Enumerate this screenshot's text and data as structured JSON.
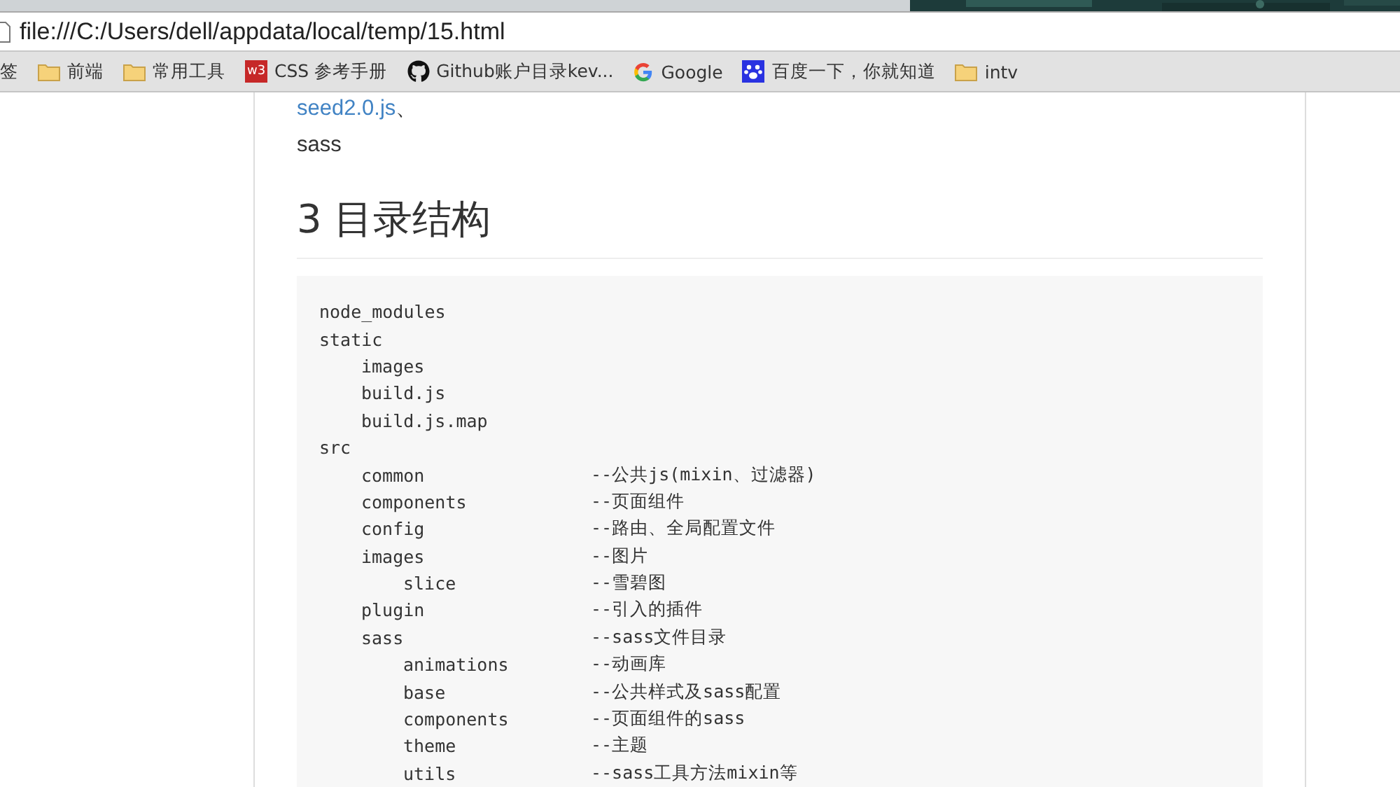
{
  "address_bar": {
    "url": "file:///C:/Users/dell/appdata/local/temp/15.html"
  },
  "bookmarks": [
    {
      "kind": "text",
      "label": "签"
    },
    {
      "kind": "folder",
      "label": "前端"
    },
    {
      "kind": "folder",
      "label": "常用工具"
    },
    {
      "kind": "w3",
      "icon_text": "w3",
      "label": "CSS 参考手册"
    },
    {
      "kind": "github",
      "label": "Github账户目录kev..."
    },
    {
      "kind": "google",
      "label": "Google"
    },
    {
      "kind": "baidu",
      "label": "百度一下，你就知道"
    },
    {
      "kind": "folder",
      "label": "intv"
    }
  ],
  "article": {
    "link": "seed2.0.js",
    "link_suffix": "、",
    "text": "sass",
    "heading": "3 目录结构",
    "tree": [
      {
        "name": "node_modules"
      },
      {
        "name": "static",
        "children": [
          {
            "name": "images"
          },
          {
            "name": "build.js"
          },
          {
            "name": "build.js.map"
          }
        ]
      },
      {
        "name": "src",
        "children": [
          {
            "name": "common",
            "comment": "--公共js(mixin、过滤器)"
          },
          {
            "name": "components",
            "comment": "--页面组件"
          },
          {
            "name": "config",
            "comment": "--路由、全局配置文件"
          },
          {
            "name": "images",
            "comment": "--图片",
            "children": [
              {
                "name": "slice",
                "comment": "--雪碧图"
              }
            ]
          },
          {
            "name": "plugin",
            "comment": "--引入的插件"
          },
          {
            "name": "sass",
            "comment": "--sass文件目录",
            "children": [
              {
                "name": "animations",
                "comment": "--动画库"
              },
              {
                "name": "base",
                "comment": "--公共样式及sass配置"
              },
              {
                "name": "components",
                "comment": "--页面组件的sass"
              },
              {
                "name": "theme",
                "comment": "--主题"
              },
              {
                "name": "utils",
                "comment": "--sass工具方法mixin等"
              }
            ]
          }
        ]
      }
    ]
  }
}
